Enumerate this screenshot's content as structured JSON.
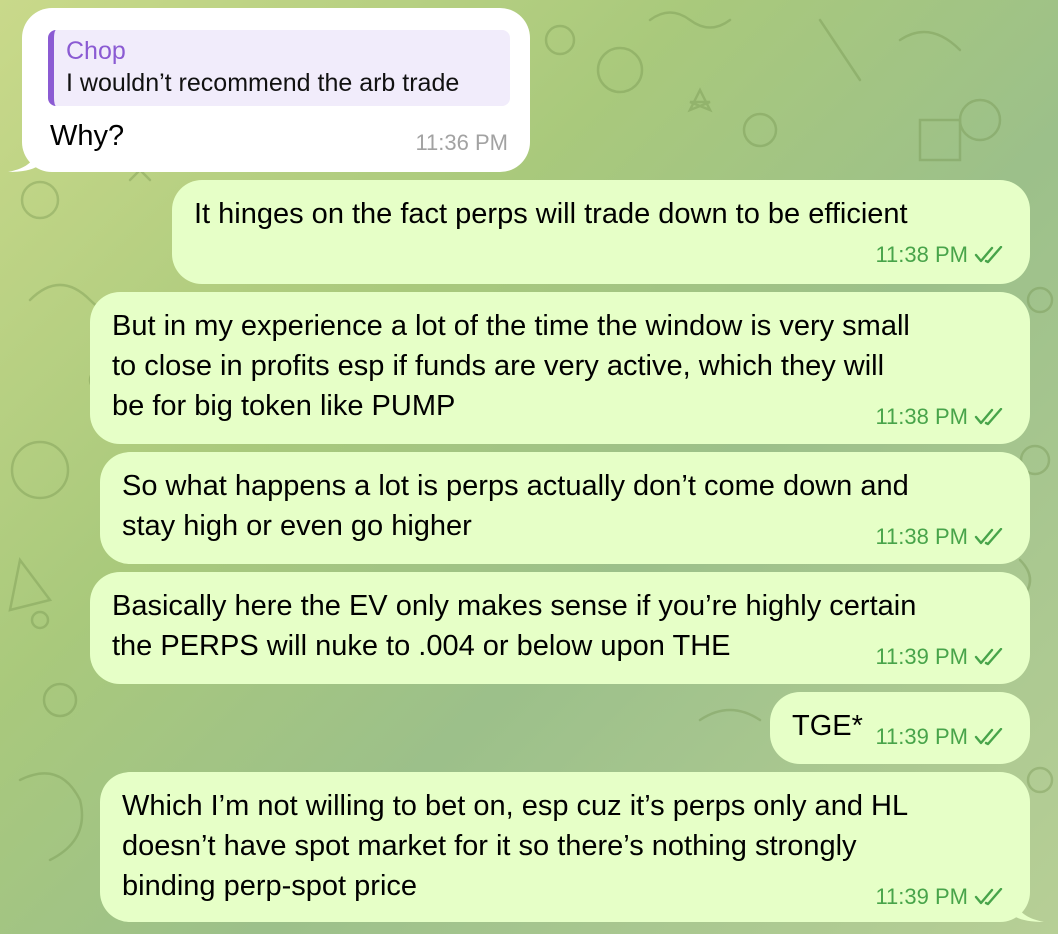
{
  "colors": {
    "incoming_bubble": "#ffffff",
    "outgoing_bubble": "#e6ffc7",
    "quote_accent": "#8b5bd3",
    "outgoing_time": "#48a44a",
    "incoming_time": "#a2a2a2"
  },
  "messages": [
    {
      "direction": "incoming",
      "reply_to": {
        "author": "Chop",
        "text": "I wouldn’t recommend the arb trade"
      },
      "text": "Why?",
      "time": "11:36 PM"
    },
    {
      "direction": "outgoing",
      "text": "It hinges on the fact perps will trade down to be efficient",
      "time": "11:38 PM",
      "status_icon": "double-check-icon"
    },
    {
      "direction": "outgoing",
      "text": "But in my experience a lot of the time the window is very small\nto close in profits esp if funds are very active, which they will\nbe for big token like PUMP",
      "time": "11:38 PM",
      "status_icon": "double-check-icon"
    },
    {
      "direction": "outgoing",
      "text": "So what happens a lot is perps actually don’t come down and\nstay high or even go higher",
      "time": "11:38 PM",
      "status_icon": "double-check-icon"
    },
    {
      "direction": "outgoing",
      "text": "Basically here the EV only makes sense if you’re highly certain\nthe PERPS will nuke to .004 or below upon THE",
      "time": "11:39 PM",
      "status_icon": "double-check-icon"
    },
    {
      "direction": "outgoing",
      "text": "TGE*",
      "time": "11:39 PM",
      "status_icon": "double-check-icon"
    },
    {
      "direction": "outgoing",
      "text": "Which I’m not willing to bet on, esp cuz it’s perps only and HL\ndoesn’t have spot market for it so there’s nothing strongly\nbinding perp-spot price",
      "time": "11:39 PM",
      "status_icon": "double-check-icon"
    }
  ]
}
